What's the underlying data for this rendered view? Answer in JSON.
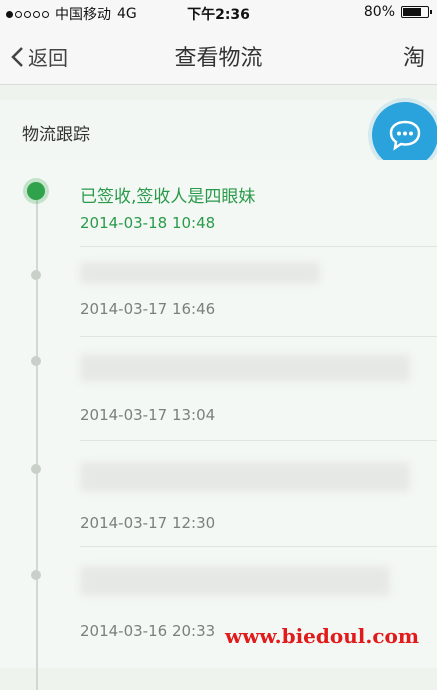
{
  "status_bar": {
    "carrier": "中国移动",
    "network": "4G",
    "time": "下午2:36",
    "battery": "80%",
    "battery_level": 0.8
  },
  "nav": {
    "back_label": "返回",
    "title": "查看物流",
    "right_label": "淘"
  },
  "tracking": {
    "header": "物流跟踪",
    "events": [
      {
        "text": "已签收,签收人是四眼妹",
        "time": "2014-03-18 10:48",
        "active": true
      },
      {
        "text": "",
        "time": "2014-03-17 16:46",
        "active": false
      },
      {
        "text": "",
        "time": "2014-03-17 13:04",
        "active": false
      },
      {
        "text": "",
        "time": "2014-03-17 12:30",
        "active": false
      },
      {
        "text": "",
        "time": "2014-03-16 20:33",
        "active": false
      }
    ]
  },
  "watermark": "www.biedoul.com",
  "colors": {
    "accent_green": "#2fa24b",
    "fab_blue": "#2aa2dc",
    "watermark_red": "#e11b1b"
  }
}
